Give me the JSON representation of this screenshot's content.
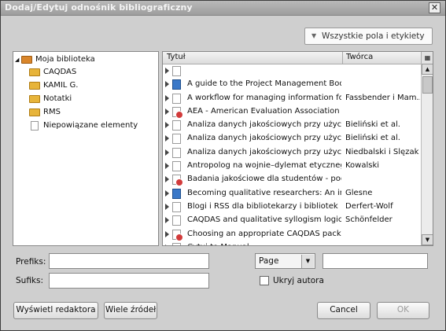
{
  "window": {
    "title": "Dodaj/Edytuj odnośnik bibliograficzny",
    "close_glyph": "✕"
  },
  "filter": {
    "label": "Wszystkie pola i etykiety"
  },
  "library": {
    "root": "Moja biblioteka",
    "folders": [
      "CAQDAS",
      "KAMIL G.",
      "Notatki",
      "RMS"
    ],
    "unfiled": "Niepowiązane elementy"
  },
  "table": {
    "columns": {
      "title": "Tytuł",
      "creator": "Twórca"
    },
    "rows": [
      {
        "icon": "page",
        "title": "",
        "creator": ""
      },
      {
        "icon": "book",
        "title": "A guide to the Project Management Body...",
        "creator": ""
      },
      {
        "icon": "page",
        "title": "A workflow for managing information for ...",
        "creator": "Fassbender i Mam..."
      },
      {
        "icon": "red",
        "title": "AEA - American Evaluation Association : ...",
        "creator": ""
      },
      {
        "icon": "page",
        "title": "Analiza danych jakościowych przy użyciu ...",
        "creator": "Bieliński et al."
      },
      {
        "icon": "page",
        "title": "Analiza danych jakościowych przy użyciu ...",
        "creator": "Bieliński et al."
      },
      {
        "icon": "page",
        "title": "Analiza danych jakościowych przy użyciu ...",
        "creator": "Niedbalski i Ślęzak"
      },
      {
        "icon": "page",
        "title": "Antropolog na wojnie–dylemat etycznego...",
        "creator": "Kowalski"
      },
      {
        "icon": "red",
        "title": "Badania jakościowe dla studentów - podr...",
        "creator": ""
      },
      {
        "icon": "book",
        "title": "Becoming qualitative researchers: An intr...",
        "creator": "Glesne"
      },
      {
        "icon": "page",
        "title": "Blogi i RSS dla bibliotekarzy i bibliotek",
        "creator": "Derfert-Wolf"
      },
      {
        "icon": "page",
        "title": "CAQDAS and qualitative syllogism logic—...",
        "creator": "Schönfelder"
      },
      {
        "icon": "red",
        "title": "Choosing an appropriate CAQDAS package",
        "creator": ""
      },
      {
        "icon": "red",
        "title": "Cytuj.to Manual",
        "creator": ""
      }
    ]
  },
  "form": {
    "prefix_label": "Prefiks:",
    "suffix_label": "Sufiks:",
    "locator_select": "Page",
    "hide_author_label": "Ukryj autora"
  },
  "buttons": {
    "editor": "Wyświetl redaktora",
    "multiple": "Wiele źródeł",
    "cancel": "Cancel",
    "ok": "OK"
  }
}
